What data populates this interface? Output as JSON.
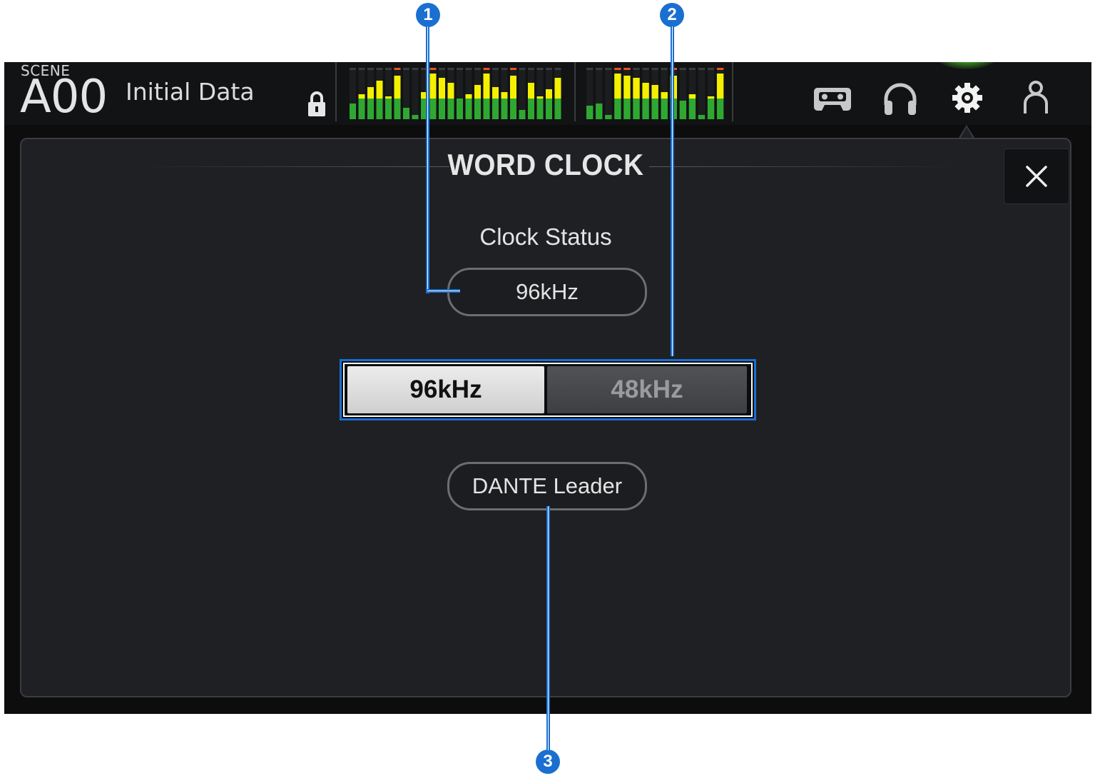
{
  "scene": {
    "caption": "SCENE",
    "number": "A00",
    "name": "Initial Data"
  },
  "toolbar": {
    "icons": [
      "recorder-icon",
      "headphones-icon",
      "gear-icon",
      "user-icon"
    ],
    "active_icon": "gear-icon"
  },
  "meters": {
    "group1_levels": [
      0.35,
      0.55,
      0.7,
      0.85,
      0.5,
      0.95,
      0.25,
      0.1,
      0.6,
      1.0,
      0.9,
      0.8,
      0.45,
      0.55,
      0.75,
      1.0,
      0.7,
      0.6,
      0.95,
      0.2,
      0.8,
      0.5,
      0.65,
      0.9
    ],
    "group2_levels": [
      0.3,
      0.35,
      0.1,
      1.0,
      0.95,
      0.9,
      0.8,
      0.75,
      0.6,
      0.95,
      0.4,
      0.55,
      0.1,
      0.5,
      1.0
    ],
    "peak_color": "#e8522b",
    "top_color": "#f4f000",
    "bottom_color": "#2fa832"
  },
  "panel": {
    "title": "WORD CLOCK",
    "close_icon": "close-icon",
    "clock_status_label": "Clock Status",
    "clock_status_value": "96kHz",
    "rate_options": [
      "96kHz",
      "48kHz"
    ],
    "selected_rate": "96kHz",
    "dante_indicator": "DANTE Leader"
  },
  "callouts": {
    "one": "1",
    "two": "2",
    "three": "3",
    "color": "#1a6fd0"
  }
}
